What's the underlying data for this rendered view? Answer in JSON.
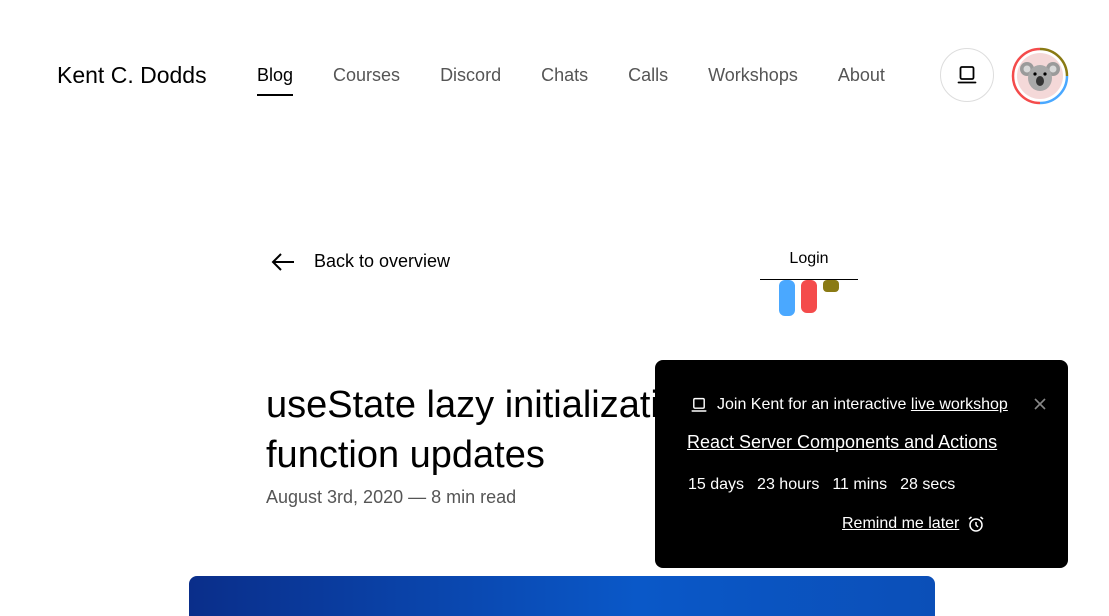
{
  "header": {
    "brand": "Kent C. Dodds",
    "nav": [
      {
        "label": "Blog",
        "active": true
      },
      {
        "label": "Courses"
      },
      {
        "label": "Discord"
      },
      {
        "label": "Chats"
      },
      {
        "label": "Calls"
      },
      {
        "label": "Workshops"
      },
      {
        "label": "About"
      }
    ],
    "laptop_icon": "laptop-icon",
    "avatar_icon": "koala-avatar"
  },
  "back_link": {
    "label": "Back to overview",
    "icon": "arrow-left-icon"
  },
  "login": {
    "label": "Login"
  },
  "bar_colors": [
    "#4aa8ff",
    "#f44b4b",
    "#8a7a14"
  ],
  "article": {
    "title": "useState lazy initialization and function updates",
    "meta": "August 3rd, 2020 — 8 min read"
  },
  "popup": {
    "intro": "Join Kent for an interactive ",
    "intro_link": "live workshop",
    "workshop_title": "React Server Components and Actions",
    "countdown": [
      "15 days",
      "23 hours",
      "11 mins",
      "28 secs"
    ],
    "remind": "Remind me later",
    "close_icon": "close-icon",
    "alarm_icon": "alarm-clock-icon"
  },
  "colors": {
    "hero_start": "#0a2e8a",
    "hero_end": "#0a58c8",
    "popup_bg": "#000000"
  }
}
